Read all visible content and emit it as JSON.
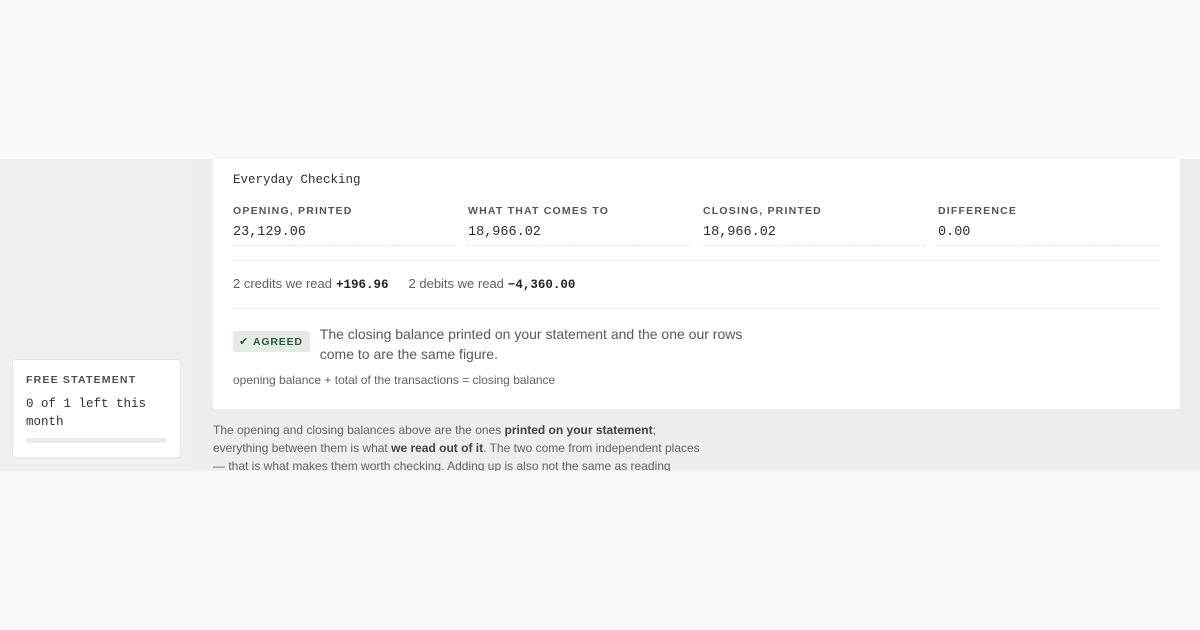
{
  "sidebar": {
    "quota": {
      "title": "FREE STATEMENT",
      "text": "0 of 1 left this month",
      "used_fraction": 0.0
    }
  },
  "account": {
    "name": "Everyday Checking"
  },
  "stats": [
    {
      "label": "OPENING, PRINTED",
      "value": "23,129.06"
    },
    {
      "label": "WHAT THAT COMES TO",
      "value": "18,966.02"
    },
    {
      "label": "CLOSING, PRINTED",
      "value": "18,966.02"
    },
    {
      "label": "DIFFERENCE",
      "value": "0.00"
    }
  ],
  "totals": {
    "credits_label": "2 credits we read",
    "credits_value": "+196.96",
    "debits_label": "2 debits we read",
    "debits_value": "−4,360.00"
  },
  "verdict": {
    "badge": "AGREED",
    "badge_icon": "checkmark-icon",
    "text": "The closing balance printed on your statement and the one our rows come to are the same figure.",
    "formula": "opening balance + total of the transactions = closing balance"
  },
  "note": {
    "part1": "The opening and closing balances above are the ones ",
    "bold1": "printed on your statement",
    "part2": "; everything between them is what ",
    "bold2": "we read out of it",
    "part3": ". The two come from independent places — that is what makes them worth checking. Adding up is also not the same as reading everything; a"
  },
  "colors": {
    "accent_green": "#2a5a3d",
    "badge_bg": "#e4ebe4",
    "page_bg": "#faf9f5"
  }
}
